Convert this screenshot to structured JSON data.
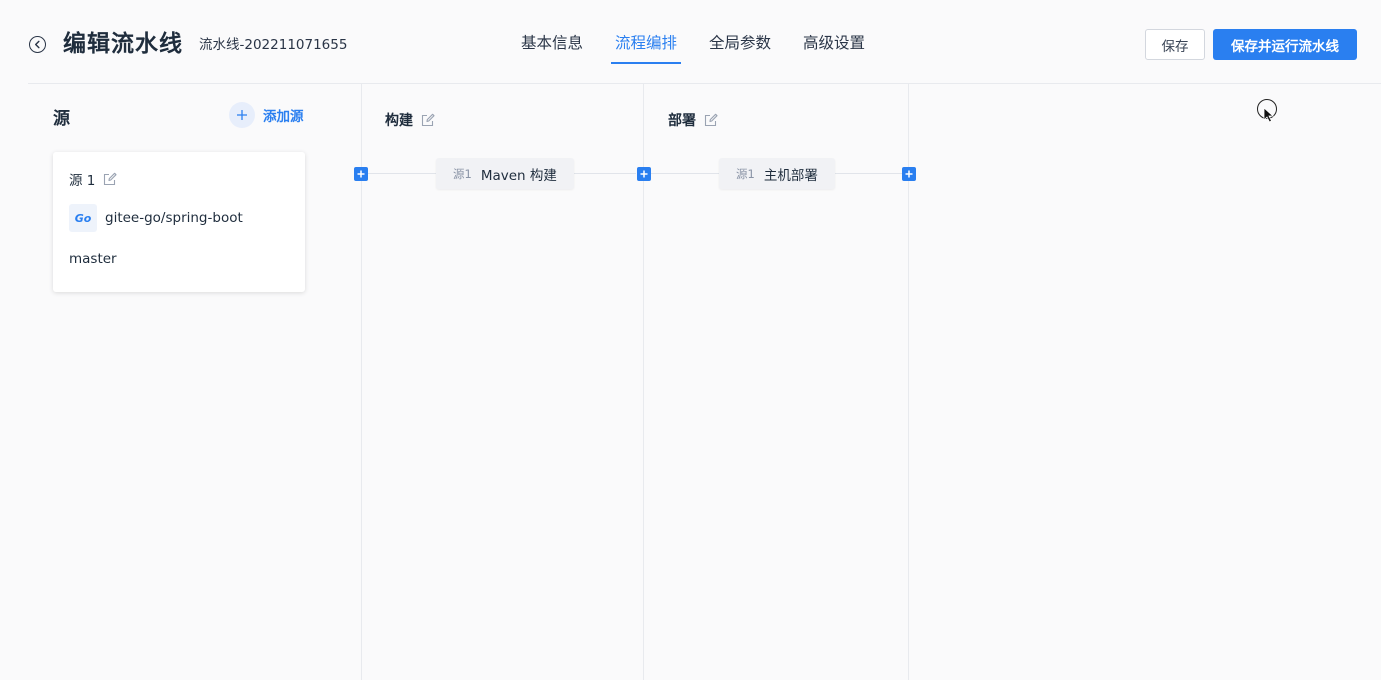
{
  "header": {
    "title": "编辑流水线",
    "subtitle": "流水线-202211071655",
    "tabs": [
      {
        "label": "基本信息",
        "active": false
      },
      {
        "label": "流程编排",
        "active": true
      },
      {
        "label": "全局参数",
        "active": false
      },
      {
        "label": "高级设置",
        "active": false
      }
    ],
    "save_label": "保存",
    "run_label": "保存并运行流水线"
  },
  "sources": {
    "title": "源",
    "add_label": "添加源",
    "card": {
      "name": "源 1",
      "logo_text": "Go",
      "repo": "gitee-go/spring-boot",
      "branch": "master"
    }
  },
  "stages": [
    {
      "title": "构建",
      "jobs": [
        {
          "source": "源1",
          "name": "Maven 构建"
        }
      ]
    },
    {
      "title": "部署",
      "jobs": [
        {
          "source": "源1",
          "name": "主机部署"
        }
      ]
    }
  ],
  "colors": {
    "accent": "#2a7ff0",
    "text": "#1f2d3d",
    "muted": "#8a94a6",
    "background": "#fafafb"
  },
  "icons": {
    "back": "back-circle-icon",
    "edit": "edit-icon",
    "add": "plus-icon",
    "logo": "go-logo-icon"
  }
}
